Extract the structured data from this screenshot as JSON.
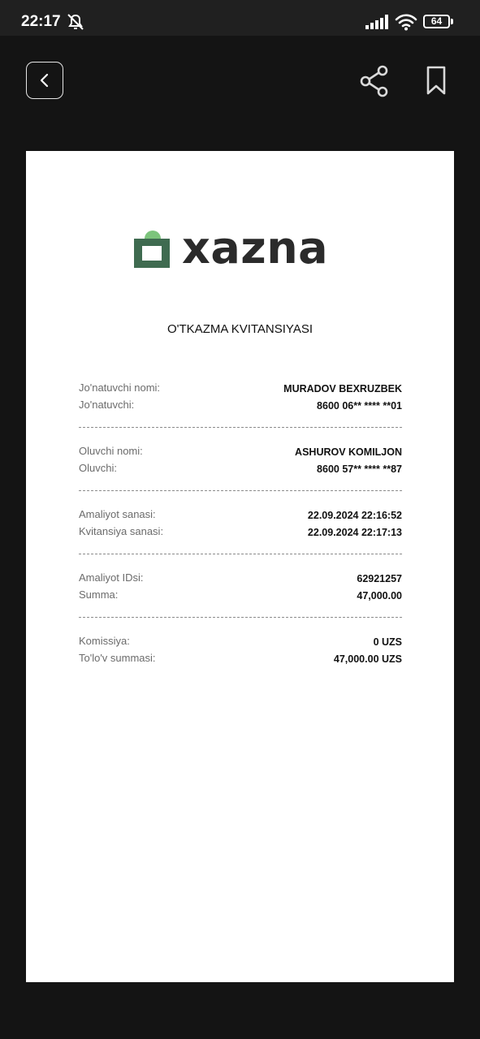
{
  "status_bar": {
    "time": "22:17",
    "battery_level": "64",
    "icons": [
      "alarm-off-icon",
      "signal-icon",
      "wifi-icon",
      "battery-icon"
    ]
  },
  "toolbar": {
    "icons": [
      "chevron-left-icon",
      "share-icon",
      "bookmark-icon"
    ]
  },
  "receipt": {
    "logo_text": "xazna",
    "logo_colors": {
      "accent": "#7cc47c",
      "dark": "#3f6b50"
    },
    "title": "O'TKAZMA KVITANSIYASI",
    "sections": [
      {
        "rows": [
          {
            "label": "Jo'natuvchi nomi:",
            "value": "MURADOV BEXRUZBEK"
          },
          {
            "label": "Jo'natuvchi:",
            "value": "8600 06** **** **01"
          }
        ]
      },
      {
        "rows": [
          {
            "label": "Oluvchi nomi:",
            "value": "ASHUROV KOMILJON"
          },
          {
            "label": "Oluvchi:",
            "value": "8600 57** **** **87"
          }
        ]
      },
      {
        "rows": [
          {
            "label": "Amaliyot sanasi:",
            "value": "22.09.2024 22:16:52"
          },
          {
            "label": "Kvitansiya sanasi:",
            "value": "22.09.2024 22:17:13"
          }
        ]
      },
      {
        "rows": [
          {
            "label": "Amaliyot IDsi:",
            "value": "62921257"
          },
          {
            "label": "Summa:",
            "value": "47,000.00"
          }
        ]
      },
      {
        "rows": [
          {
            "label": "Komissiya:",
            "value": "0 UZS"
          },
          {
            "label": "To'lo'v summasi:",
            "value": "47,000.00 UZS"
          }
        ]
      }
    ]
  }
}
